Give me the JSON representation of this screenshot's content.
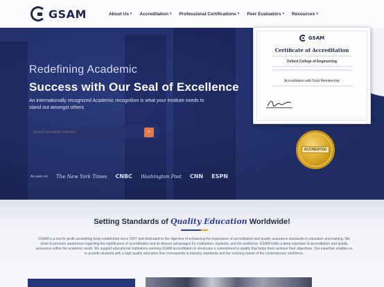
{
  "header": {
    "logo_text": "GSAM",
    "nav": [
      {
        "label": "About Us"
      },
      {
        "label": "Accreditation"
      },
      {
        "label": "Professional Certifications"
      },
      {
        "label": "Peer Evaluators"
      },
      {
        "label": "Resources"
      }
    ]
  },
  "hero": {
    "eyebrow": "Redefining Academic",
    "headline": "Success with Our Seal of Excellence",
    "subhead": "An internationally recognized Academic recognition is what your institute needs to stand out amongst others",
    "search_placeholder": "Search accredited institutes",
    "press_label": "As seen on",
    "press_logos": [
      "The New York Times",
      "CNBC",
      "Washington Post",
      "CNN",
      "ESPN"
    ]
  },
  "certificate": {
    "logo_text": "GSAM",
    "title": "Certificate of Accreditation",
    "recipient": "Oxford College of Engineering",
    "program": "Accreditation with Gold Membership",
    "seal_text": "ACCREDITED"
  },
  "section": {
    "title_prefix": "Setting Standards of",
    "title_emphasis": "Quality Education",
    "title_suffix": "Worldwide!",
    "paragraph": "GSAM is a not-for-profit accrediting body established since 2007 and dedicated to the objective of enhancing the importance of accreditation and quality assurance standards in education and training. We strive to promote awareness regarding the significance of accreditation and its diverse advantages for institutions, students, and the workforce. GSAM holds a deep expertise in accreditation and quality assurance within the academic world. We support educational institutions seeking GSAM accreditation to showcase a commitment to quality that helps them achieve their objectives. Our expertise enables us to provide students with a high quality education that corresponds to industry standards and the evolving needs of the contemporary workforce."
  },
  "colors": {
    "hero_bg": "#27366d",
    "accent_blue": "#2b3f9a",
    "accent_orange": "#e07a4a",
    "seal_gold": "#d6a21e"
  }
}
